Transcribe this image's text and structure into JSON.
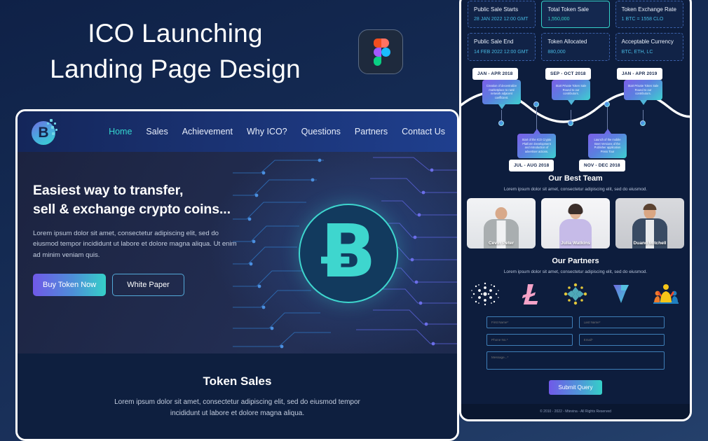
{
  "poster": {
    "title_line1": "ICO Launching",
    "title_line2": "Landing Page Design",
    "badge_icon": "figma-icon"
  },
  "site": {
    "brand": {
      "logo_icon": "bitcoin-coin-logo",
      "logo_letter": "B"
    },
    "nav": [
      {
        "label": "Home",
        "active": true
      },
      {
        "label": "Sales",
        "active": false
      },
      {
        "label": "Achievement",
        "active": false
      },
      {
        "label": "Why ICO?",
        "active": false
      },
      {
        "label": "Questions",
        "active": false
      },
      {
        "label": "Partners",
        "active": false
      },
      {
        "label": "Contact Us",
        "active": false
      }
    ],
    "hero": {
      "heading_line1": "Easiest way to transfer,",
      "heading_line2": "sell & exchange crypto coins...",
      "paragraph": "Lorem ipsum dolor sit amet, consectetur adipiscing elit, sed do eiusmod tempor incididunt ut labore et dolore magna aliqua. Ut enim ad minim veniam quis.",
      "primary_button": "Buy Token Now",
      "secondary_button": "White Paper",
      "artwork_icon": "bitcoin-circuit-graphic",
      "artwork_symbol": "Ƀ"
    },
    "token_sales": {
      "title": "Token Sales",
      "paragraph": "Lorem ipsum dolor sit amet, consectetur adipiscing elit, sed do eiusmod tempor incididunt ut labore et dolore magna aliqua."
    }
  },
  "right_page": {
    "token_cards": [
      {
        "label": "Public Sale Starts",
        "value": "28 JAN 2022 12:00 GMT",
        "highlight": false
      },
      {
        "label": "Total Token Sale",
        "value": "1,550,000",
        "highlight": true
      },
      {
        "label": "Token Exchange Rate",
        "value": "1 BTC = 1558 CLO",
        "highlight": false
      },
      {
        "label": "Public Sale End",
        "value": "14 FEB 2022 12:00 GMT",
        "highlight": false
      },
      {
        "label": "Token Allocated",
        "value": "880,000",
        "highlight": false
      },
      {
        "label": "Acceptable Currency",
        "value": "BTC, ETH, LC",
        "highlight": false
      }
    ],
    "roadmap": [
      {
        "date": "JAN - APR 2018",
        "text": "Creation of decentralize marketplace to rural network adjacent coefficient.",
        "position": "above"
      },
      {
        "date": "SEP - OCT 2018",
        "text": "Start Private Token Sale Round to our contributors.",
        "position": "above"
      },
      {
        "date": "JAN - APR 2019",
        "text": "Start Private Token Sale Round to our contributors.",
        "position": "above"
      },
      {
        "date": "JUL - AUG 2018",
        "text": "Start of the ICO Crypto Platform Development and introduction of advertiser actions.",
        "position": "below"
      },
      {
        "date": "NOV - DEC 2018",
        "text": "Launch of the mobile Beet Versions of the Publisher application Press Tour",
        "position": "below"
      }
    ],
    "team": {
      "title": "Our Best Team",
      "subtitle": "Lorem ipsum dolor sit amet, consectetur adipiscing elit, sed do eiusmod.",
      "members": [
        {
          "name": "Cevin Peter"
        },
        {
          "name": "Julia Watkins"
        },
        {
          "name": "Duand Mitchell"
        }
      ]
    },
    "partners": {
      "title": "Our Partners",
      "subtitle": "Lorem ipsum dolor sit amet, consectetur adipiscing elit, sed do eiusmod.",
      "logos": [
        {
          "icon": "cardano-logo"
        },
        {
          "icon": "litecoin-logo"
        },
        {
          "icon": "cross-network-logo"
        },
        {
          "icon": "triangle-arrow-logo"
        },
        {
          "icon": "people-celebration-logo"
        }
      ]
    },
    "form": {
      "first_name_placeholder": "First Name*",
      "last_name_placeholder": "Last Name*",
      "phone_placeholder": "Phone No.*",
      "email_placeholder": "Email*",
      "message_placeholder": "Message...*",
      "submit_label": "Submit Query"
    },
    "footer": "© 2010 - 2022 - Mtevina - All Rights Reserved"
  },
  "colors": {
    "accent_teal": "#35d0c8",
    "accent_purple": "#7059e8",
    "page_bg": "#0d1d3d",
    "nav_bg": "#1a3272"
  }
}
